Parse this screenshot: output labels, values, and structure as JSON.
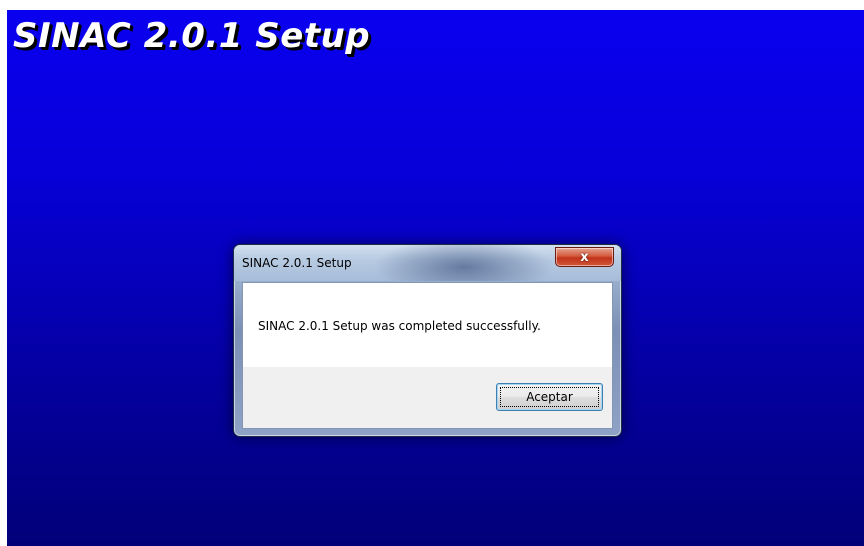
{
  "background": {
    "title": "SINAC 2.0.1 Setup",
    "colors": {
      "gradient_top": "#0a00f0",
      "gradient_bottom": "#020078",
      "title_text": "#ffffff",
      "title_shadow": "#000000"
    }
  },
  "dialog": {
    "title": "SINAC 2.0.1 Setup",
    "close_icon": "close-icon",
    "close_glyph": "x",
    "message": "SINAC 2.0.1 Setup was completed successfully.",
    "ok_label": "Aceptar",
    "colors": {
      "close_button": "#c1341a",
      "client_background": "#ffffff",
      "footer_background": "#f0f0f0",
      "focus_border": "#3c7fb1"
    }
  }
}
